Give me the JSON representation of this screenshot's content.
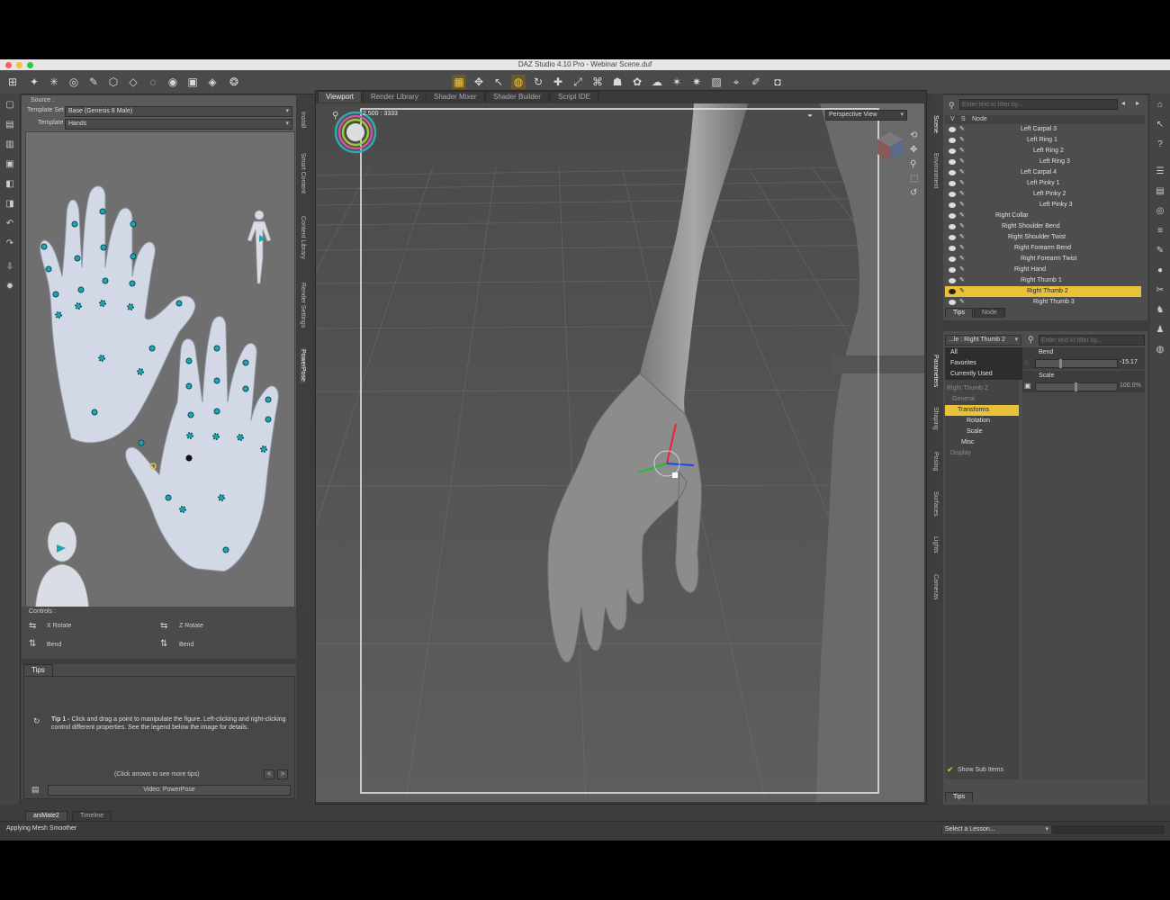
{
  "window": {
    "title": "DAZ Studio 4.10 Pro - Webinar Scene.duf"
  },
  "colors": {
    "accent": "#e9c23a",
    "point": "#1fa5b3",
    "viewport_bg": "#5b5b5b"
  },
  "toolbar": {
    "icons": [
      "scene-icon",
      "pose-tool-icon",
      "joint-editor-icon",
      "region-icon",
      "node-weight-icon",
      "geometry-icon",
      "cube-icon",
      "universal-icon",
      "target-icon",
      "dual-cube-icon",
      "spot-render-icon",
      "active-pose-icon",
      "rotate-icon",
      "pointer-icon",
      "gold-ring-icon",
      "refresh-icon",
      "move-icon",
      "scale-icon",
      "node-icon",
      "brush-icon",
      "figure-icon",
      "cloud-icon",
      "shape-icon",
      "light-icon",
      "texture-icon",
      "camera-add-icon",
      "pin-icon",
      "camera-icon"
    ]
  },
  "powerpose": {
    "source_label": "Source :",
    "template_set_label": "Template Set :",
    "template_set_value": "Base (Genesis 8 Male)",
    "template_label": "Template :",
    "template_value": "Hands",
    "controls_label": "Controls :",
    "controls": [
      {
        "label": "X Rotate"
      },
      {
        "label": "Z Rotate"
      },
      {
        "label": "Bend"
      },
      {
        "label": "Bend"
      }
    ]
  },
  "left_vtabs": [
    "Install",
    "Smart Content",
    "Content Library",
    "Render Settings",
    "PowerPose"
  ],
  "tips_panel": {
    "tab": "Tips",
    "tip_bold": "Tip 1 -",
    "tip_text": "Click and drag a point to manipulate the figure. Left-clicking and right-clicking control different properties. See the legend below the image for details.",
    "nav_text": "(Click arrows to see more tips)",
    "prev": "<",
    "next": ">",
    "video_button": "Video: PowerPose"
  },
  "viewport": {
    "tabs": [
      "Viewport",
      "Render Library",
      "Shader Mixer",
      "Shader Builder",
      "Script IDE"
    ],
    "active_tab": "Viewport",
    "aspect": "2.500 : 3333",
    "view_select": "Perspective View"
  },
  "scene": {
    "filter_placeholder": "Enter text to filter by...",
    "col_v": "V",
    "col_s": "S",
    "col_node": "Node",
    "nodes": [
      {
        "label": "Left Carpal 3",
        "indent": 8
      },
      {
        "label": "Left Ring 1",
        "indent": 9
      },
      {
        "label": "Left Ring 2",
        "indent": 10
      },
      {
        "label": "Left Ring 3",
        "indent": 11
      },
      {
        "label": "Left Carpal 4",
        "indent": 8
      },
      {
        "label": "Left Pinky 1",
        "indent": 9
      },
      {
        "label": "Left Pinky 2",
        "indent": 10
      },
      {
        "label": "Left Pinky 3",
        "indent": 11
      },
      {
        "label": "Right Collar",
        "indent": 4
      },
      {
        "label": "Right Shoulder Bend",
        "indent": 5
      },
      {
        "label": "Right Shoulder Twist",
        "indent": 6
      },
      {
        "label": "Right Forearm Bend",
        "indent": 7
      },
      {
        "label": "Right Forearm Twist",
        "indent": 8
      },
      {
        "label": "Right Hand",
        "indent": 7
      },
      {
        "label": "Right Thumb 1",
        "indent": 8
      },
      {
        "label": "Right Thumb 2",
        "indent": 9,
        "selected": true
      },
      {
        "label": "Right Thumb 3",
        "indent": 10
      }
    ],
    "tabs": [
      "Tips",
      "Node"
    ]
  },
  "right_vtabs": [
    "Scene",
    "Environment"
  ],
  "right_vtabs2": [
    "Parameters",
    "Shaping",
    "Posing",
    "Surfaces",
    "Lights",
    "Cameras"
  ],
  "parameters": {
    "node_select": "...le : Right Thumb 2",
    "filter_placeholder": "Enter text to filter by...",
    "groups": [
      "All",
      "Favorites",
      "Currently Used"
    ],
    "tree": [
      {
        "label": "Right Thumb 2",
        "dim": true
      },
      {
        "label": "General",
        "dim": true
      },
      {
        "label": "Transforms",
        "selected": true
      },
      {
        "label": "Rotation"
      },
      {
        "label": "Scale"
      },
      {
        "label": "Misc"
      },
      {
        "label": "Display",
        "dim": true
      }
    ],
    "sliders": [
      {
        "label": "Bend",
        "value": "-15.17",
        "fraction": 0.3
      },
      {
        "label": "Scale",
        "value": "100.0%",
        "fraction": 0.5
      }
    ],
    "show_sub_items": "Show Sub Items",
    "tips_tab": "Tips"
  },
  "bottom": {
    "tabs": [
      "aniMate2",
      "Timeline"
    ],
    "status": "Applying Mesh Smoother",
    "lesson_select": "Select a Lesson..."
  }
}
